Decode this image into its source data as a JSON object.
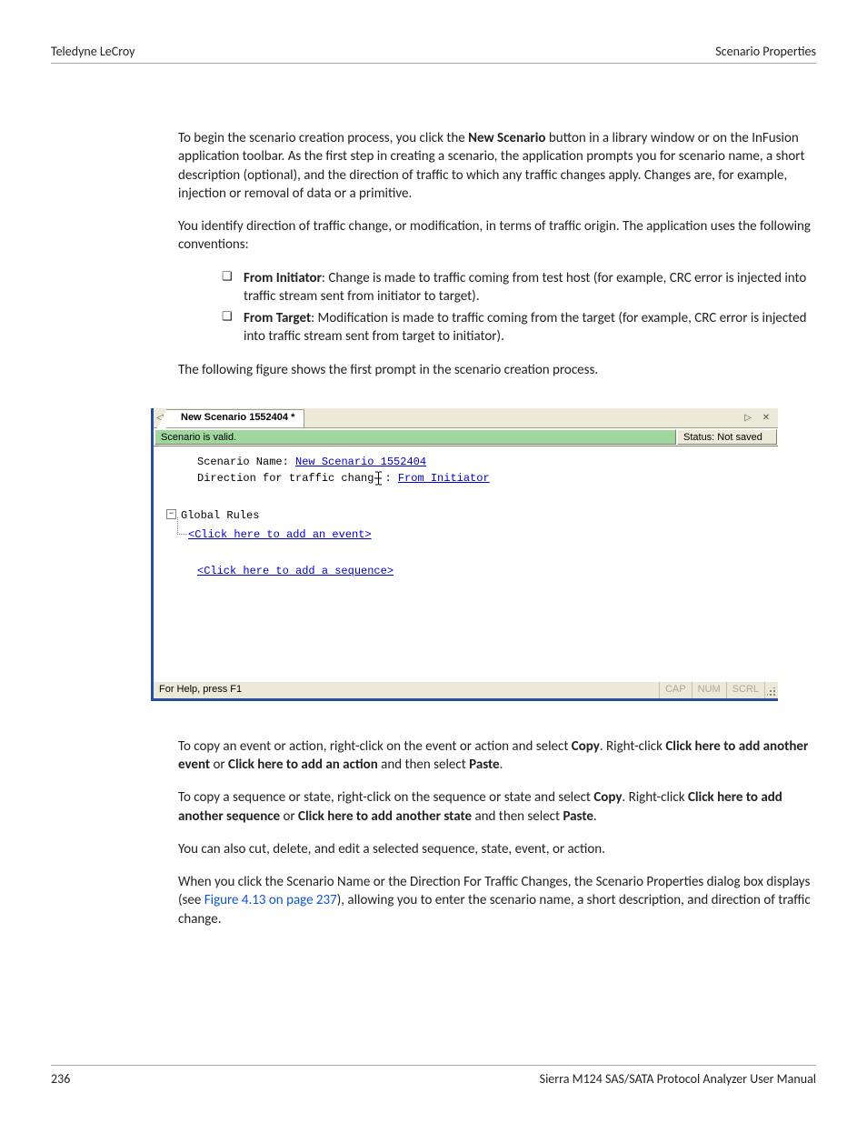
{
  "header": {
    "left": "Teledyne LeCroy",
    "right": "Scenario Properties"
  },
  "para1": {
    "a": "To begin the scenario creation process, you click the ",
    "b": "New Scenario",
    "c": " button in a library window or on the InFusion application toolbar. As the first step in creating a scenario, the application prompts you for scenario name, a short description (optional), and the direction of traffic to which any traffic changes apply. Changes are, for example, injection or removal of data or a primitive."
  },
  "para2": "You identify direction of traffic change, or modification, in terms of traffic origin. The application uses the following conventions:",
  "bullets": {
    "b1a": "From Initiator",
    "b1b": ": Change is made to traffic coming from test host (for example, CRC error is injected into traffic stream sent from initiator to target).",
    "b2a": "From Target",
    "b2b": ": Modification is made to traffic coming from the target (for example, CRC error is injected into traffic stream sent from target to initiator)."
  },
  "para3": "The following figure shows the first prompt in the scenario creation process.",
  "app": {
    "tabnav_left": "◁",
    "tab_title": "New Scenario 1552404 *",
    "tabnav_right": "▷",
    "close_glyph": "✕",
    "valid_text": "Scenario is valid.",
    "status_text": "Status: Not saved",
    "editor": {
      "name_label": "Scenario Name: ",
      "name_value": "New Scenario 1552404",
      "dir_label_a": "Direction for traffic chang",
      "dir_label_b": ": ",
      "dir_value": "From Initiator",
      "global_rules": "Global Rules",
      "add_event": "<Click here to add an event>",
      "add_sequence": "<Click here to add a sequence>"
    },
    "bottom": {
      "help": "For Help, press F1",
      "cap": "CAP",
      "num": "NUM",
      "scrl": "SCRL"
    }
  },
  "para4": {
    "a": "To copy an event or action, right-click on the event or action and select ",
    "b": "Copy",
    "c": ". Right-click ",
    "d": "Click here to add another event",
    "e": " or ",
    "f": "Click here to add an action",
    "g": " and then select ",
    "h": "Paste",
    "i": "."
  },
  "para5": {
    "a": "To copy a sequence or state, right-click on the sequence or state and select ",
    "b": "Copy",
    "c": ". Right-click ",
    "d": "Click here to add another sequence",
    "e": " or ",
    "f": "Click here to add another state",
    "g": " and then select ",
    "h": "Paste",
    "i": "."
  },
  "para6": "You can also cut, delete, and edit a selected sequence, state, event, or action.",
  "para7": {
    "a": "When you click the Scenario Name or the Direction For Traffic Changes, the Scenario Properties dialog box displays (see ",
    "xref": "Figure 4.13 on page 237",
    "b": "), allowing you to enter the scenario name, a short description, and direction of traffic change."
  },
  "footer": {
    "page": "236",
    "manual": "Sierra M124 SAS/SATA Protocol Analyzer User Manual"
  }
}
